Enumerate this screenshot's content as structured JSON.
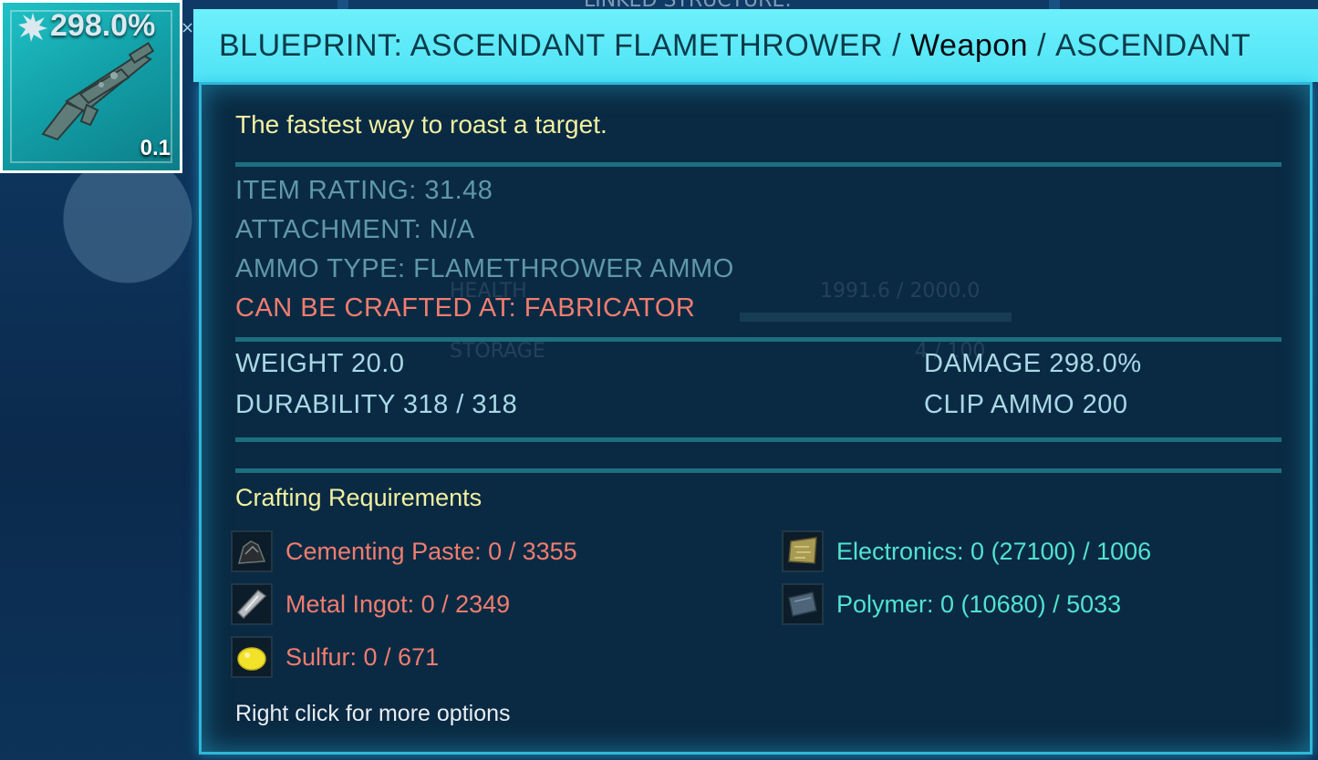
{
  "item_slot": {
    "damage_percent": "298.0%",
    "close_glyph": "×",
    "weight": "0.1",
    "icon": "flamethrower-icon"
  },
  "background": {
    "linked_structure_text": "LINKED STRUCTURE:",
    "health_label": "HEALTH",
    "health_value": "1991.6 / 2000.0",
    "storage_label": "STORAGE",
    "storage_value": "4 / 100"
  },
  "title": {
    "main": "BLUEPRINT: ASCENDANT FLAMETHROWER",
    "separator": "/",
    "category": "Weapon",
    "separator2": "/",
    "quality": "ASCENDANT"
  },
  "description": "The fastest way to roast a target.",
  "stats": {
    "item_rating": "ITEM RATING: 31.48",
    "attachment": "ATTACHMENT: N/A",
    "ammo_type": "AMMO TYPE: FLAMETHROWER AMMO",
    "crafted_at": "CAN BE CRAFTED AT: FABRICATOR"
  },
  "properties": {
    "weight": "WEIGHT 20.0",
    "durability": "DURABILITY 318 / 318",
    "damage": "DAMAGE 298.0%",
    "clip_ammo": "CLIP AMMO 200"
  },
  "crafting": {
    "title": "Crafting Requirements",
    "requirements": [
      {
        "label": "Cementing Paste: 0 / 3355",
        "icon": "cementing-paste-icon",
        "status": "insufficient"
      },
      {
        "label": "Metal Ingot: 0 / 2349",
        "icon": "metal-ingot-icon",
        "status": "insufficient"
      },
      {
        "label": "Sulfur: 0 / 671",
        "icon": "sulfur-icon",
        "status": "insufficient"
      },
      {
        "label": "Electronics: 0 (27100) / 1006",
        "icon": "electronics-icon",
        "status": "available"
      },
      {
        "label": "Polymer: 0 (10680) / 5033",
        "icon": "polymer-icon",
        "status": "available"
      }
    ]
  },
  "hint": "Right click for more options",
  "colors": {
    "title_bar": "#4fe3f6",
    "panel_bg": "#0a2a43",
    "insufficient": "#f07d6f",
    "available": "#52e2d0",
    "description": "#f1f0a0"
  }
}
